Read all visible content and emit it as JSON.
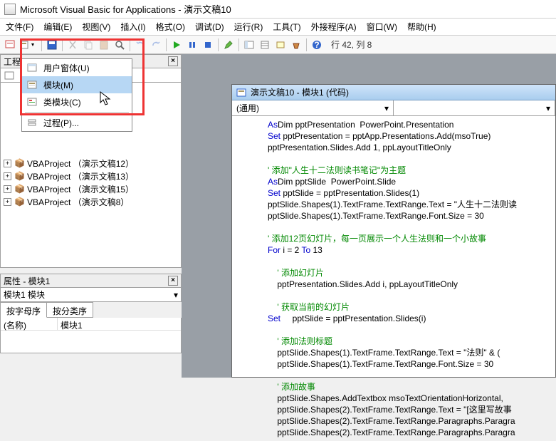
{
  "title": "Microsoft Visual Basic for Applications - 演示文稿10",
  "menu": [
    "文件(F)",
    "编辑(E)",
    "视图(V)",
    "插入(I)",
    "格式(O)",
    "调试(D)",
    "运行(R)",
    "工具(T)",
    "外接程序(A)",
    "窗口(W)",
    "帮助(H)"
  ],
  "toolbar_status": "行 42, 列 8",
  "dropdown": {
    "items": [
      {
        "icon": "form",
        "label": "用户窗体(U)"
      },
      {
        "icon": "module",
        "label": "模块(M)"
      },
      {
        "icon": "class",
        "label": "类模块(C)"
      }
    ],
    "proc": "过程(P)..."
  },
  "project_pane_title": "工程",
  "projects": [
    "VBAProject （演示文稿12）",
    "VBAProject （演示文稿13）",
    "VBAProject （演示文稿15）",
    "VBAProject （演示文稿8）"
  ],
  "props_title": "属性 - 模块1",
  "props_combo": "模块1 模块",
  "props_tabs": [
    "按字母序",
    "按分类序"
  ],
  "props_name_key": "(名称)",
  "props_name_val": "模块1",
  "codewin_title": "演示文稿10 - 模块1 (代码)",
  "code_combo_left": "(通用)",
  "code_combo_right": "",
  "code_lines": [
    {
      "t": "Dim pptPresentation ",
      "k": "As",
      "t2": " PowerPoint.Presentation"
    },
    {
      "k": "Set",
      "t": " pptPresentation = pptApp.Presentations.Add(msoTrue)"
    },
    {
      "t": "pptPresentation.Slides.Add 1, ppLayoutTitleOnly"
    },
    {
      "t": ""
    },
    {
      "c": "' 添加\"人生十二法则读书笔记\"为主题"
    },
    {
      "t": "Dim pptSlide ",
      "k": "As",
      "t2": " PowerPoint.Slide"
    },
    {
      "k": "Set",
      "t": " pptSlide = pptPresentation.Slides(1)"
    },
    {
      "t": "pptSlide.Shapes(1).TextFrame.TextRange.Text = \"人生十二法则读"
    },
    {
      "t": "pptSlide.Shapes(1).TextFrame.TextRange.Font.Size = 30"
    },
    {
      "t": ""
    },
    {
      "c": "' 添加12页幻灯片，每一页展示一个人生法则和一个小故事"
    },
    {
      "k": "For",
      "t": " i = 2 ",
      "k2": "To",
      "t2": " 13"
    },
    {
      "t": ""
    },
    {
      "c": "    ' 添加幻灯片"
    },
    {
      "t": "    pptPresentation.Slides.Add i, ppLayoutTitleOnly"
    },
    {
      "t": ""
    },
    {
      "c": "    ' 获取当前的幻灯片"
    },
    {
      "t": "    ",
      "k": "Set",
      "t2": " pptSlide = pptPresentation.Slides(i)"
    },
    {
      "t": ""
    },
    {
      "c": "    ' 添加法则标题"
    },
    {
      "t": "    pptSlide.Shapes(1).TextFrame.TextRange.Text = \"法则\" & ("
    },
    {
      "t": "    pptSlide.Shapes(1).TextFrame.TextRange.Font.Size = 30"
    },
    {
      "t": ""
    },
    {
      "c": "    ' 添加故事"
    },
    {
      "t": "    pptSlide.Shapes.AddTextbox msoTextOrientationHorizontal,"
    },
    {
      "t": "    pptSlide.Shapes(2).TextFrame.TextRange.Text = \"[这里写故事"
    },
    {
      "t": "    pptSlide.Shapes(2).TextFrame.TextRange.Paragraphs.Paragra"
    },
    {
      "t": "    pptSlide.Shapes(2).TextFrame.TextRange.Paragraphs.Paragra"
    }
  ]
}
